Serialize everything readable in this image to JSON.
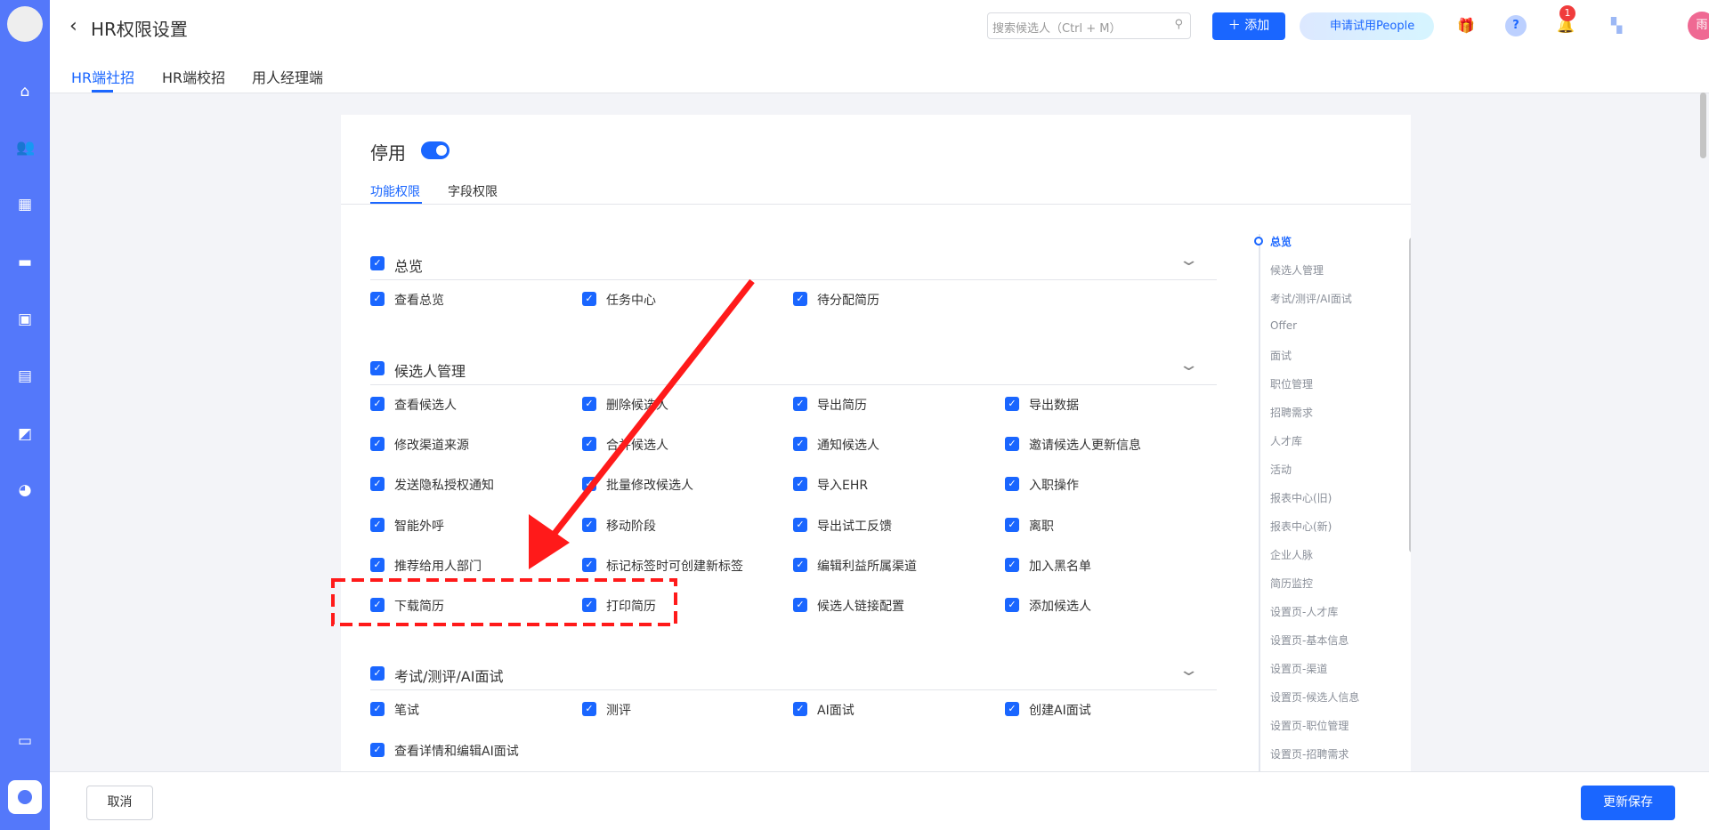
{
  "header": {
    "title": "HR权限设置",
    "tabs": [
      "HR端社招",
      "HR端校招",
      "用人经理端"
    ],
    "search_placeholder": "搜索候选人（Ctrl + M）",
    "add_label": "添加",
    "apply_label": "申请试用People",
    "notification_count": "1",
    "avatar_text": "雨"
  },
  "card": {
    "status_label": "停用",
    "status_on": true,
    "subtabs": [
      "功能权限",
      "字段权限"
    ],
    "sections": [
      {
        "label": "总览",
        "items": [
          "查看总览",
          "任务中心",
          "待分配简历"
        ]
      },
      {
        "label": "候选人管理",
        "items": [
          "查看候选人",
          "删除候选人",
          "导出简历",
          "导出数据",
          "修改渠道来源",
          "合并候选人",
          "通知候选人",
          "邀请候选人更新信息",
          "发送隐私授权通知",
          "批量修改候选人",
          "导入EHR",
          "入职操作",
          "智能外呼",
          "移动阶段",
          "导出试工反馈",
          "离职",
          "推荐给用人部门",
          "标记标签时可创建新标签",
          "编辑利益所属渠道",
          "加入黑名单",
          "下载简历",
          "打印简历",
          "候选人链接配置",
          "添加候选人"
        ]
      },
      {
        "label": "考试/测评/AI面试",
        "items": [
          "笔试",
          "测评",
          "AI面试",
          "创建AI面试",
          "查看详情和编辑AI面试"
        ]
      }
    ]
  },
  "nav": [
    "总览",
    "候选人管理",
    "考试/测评/AI面试",
    "Offer",
    "面试",
    "职位管理",
    "招聘需求",
    "人才库",
    "活动",
    "报表中心(旧)",
    "报表中心(新)",
    "企业人脉",
    "简历监控",
    "设置页-人才库",
    "设置页-基本信息",
    "设置页-渠道",
    "设置页-候选人信息",
    "设置页-职位管理",
    "设置页-招聘需求"
  ],
  "footer": {
    "cancel": "取消",
    "save": "更新保存"
  },
  "colors": {
    "accent": "#1a66ff",
    "sidebar": "#5478fa",
    "annotation": "#ff1a1a"
  }
}
